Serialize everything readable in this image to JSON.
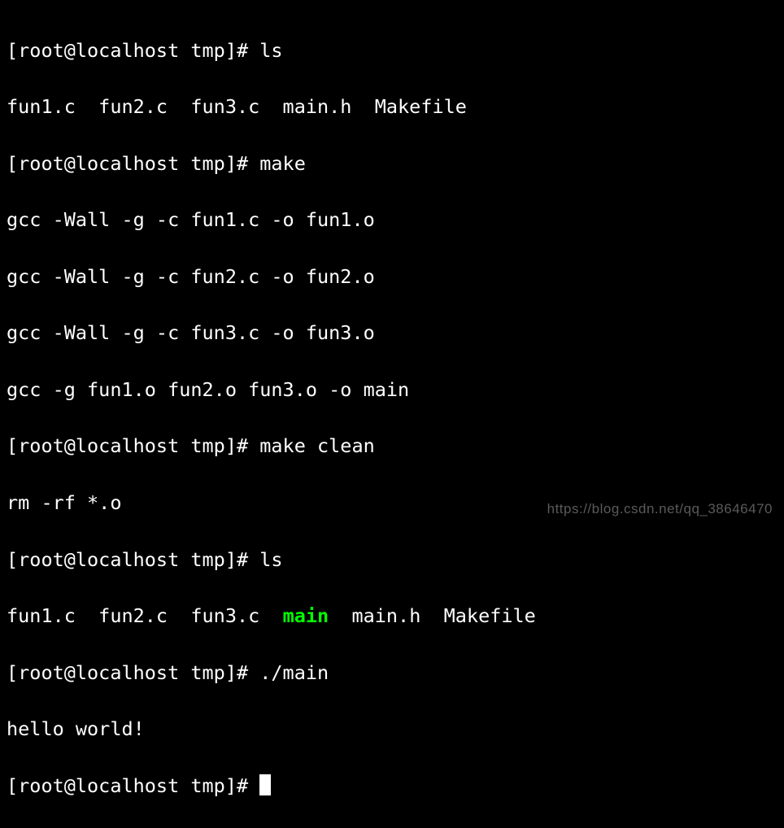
{
  "prompt": "[root@localhost tmp]# ",
  "lines": {
    "cmd1": "ls",
    "out1": "fun1.c  fun2.c  fun3.c  main.h  Makefile",
    "cmd2": "make",
    "out2a": "gcc -Wall -g -c fun1.c -o fun1.o",
    "out2b": "gcc -Wall -g -c fun2.c -o fun2.o",
    "out2c": "gcc -Wall -g -c fun3.c -o fun3.o",
    "out2d": "gcc -g fun1.o fun2.o fun3.o -o main",
    "cmd3": "make clean",
    "out3": "rm -rf *.o",
    "cmd4": "ls",
    "out4_pre": "fun1.c  fun2.c  fun3.c  ",
    "out4_exec": "main",
    "out4_post": "  main.h  Makefile",
    "cmd5": "./main",
    "out5": "hello world!",
    "cmd6": ""
  },
  "watermark": "https://blog.csdn.net/qq_38646470",
  "colors": {
    "background": "#000000",
    "foreground": "#ffffff",
    "executable": "#00ff00"
  }
}
